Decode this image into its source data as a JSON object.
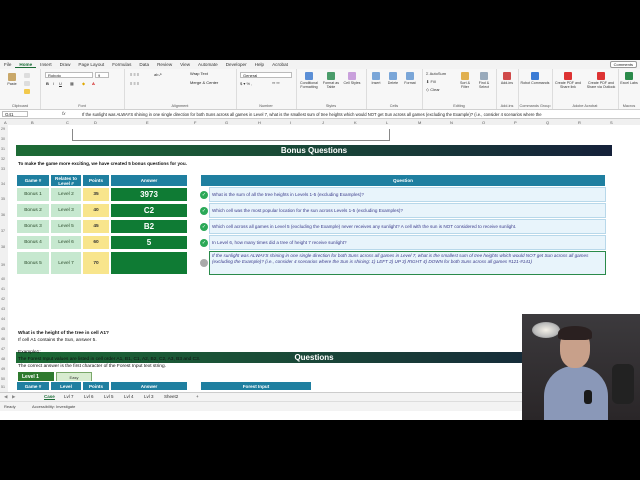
{
  "menu": {
    "tabs": [
      "File",
      "Home",
      "Insert",
      "Draw",
      "Page Layout",
      "Formulas",
      "Data",
      "Review",
      "View",
      "Automate",
      "Developer",
      "Help",
      "Acrobat"
    ],
    "active": "Home",
    "comments_label": "Comments"
  },
  "ribbon": {
    "groups": [
      "Clipboard",
      "Font",
      "Alignment",
      "Number",
      "Styles",
      "Cells",
      "Editing",
      "Add-ins",
      "Commands Group",
      "Adobe Acrobat",
      "Macros"
    ],
    "font_name": "Roboto",
    "font_size": "9",
    "number_format": "General",
    "wrap_text": "Wrap Text",
    "merge_center": "Merge & Center",
    "paste": "Paste",
    "conditional_formatting": "Conditional Formatting",
    "format_as_table": "Format as Table",
    "cell_styles": "Cell Styles",
    "insert": "Insert",
    "delete": "Delete",
    "format": "Format",
    "autosum": "AutoSum",
    "fill": "Fill",
    "clear": "Clear",
    "sort_filter": "Sort & Filter",
    "find_select": "Find & Select",
    "addins": "Add-ins",
    "robot_commands": "Robot Commands",
    "create_pdf_share": "Create PDF and Share link",
    "create_pdf_outlook": "Create PDF and Share via Outlook",
    "excel_labs": "Excel Labs"
  },
  "formula_bar": {
    "name_box": "G41",
    "fx": "fx",
    "formula": "If the sunlight was ALWAYS shining in one single direction for both Suns across all games in Level 7, what is the smallest sum of tree heights which would NOT get Sun across all games (excluding the Example)? (i.e., consider 4 scenarios where the"
  },
  "columns": [
    "A",
    "B",
    "C",
    "D",
    "E",
    "F",
    "G",
    "H",
    "I",
    "J",
    "K",
    "L",
    "M",
    "N",
    "O",
    "P",
    "Q",
    "R",
    "S"
  ],
  "rows": [
    "29",
    "30",
    "31",
    "32",
    "33",
    "34",
    "35",
    "36",
    "37",
    "38",
    "39",
    "40",
    "41",
    "42",
    "43",
    "44",
    "45",
    "46",
    "47",
    "48",
    "49",
    "50",
    "51",
    "52",
    "53",
    "54"
  ],
  "bonus": {
    "title": "Bonus Questions",
    "intro": "To make the game more exciting, we have created 5 bonus questions for you.",
    "headers": [
      "Game #",
      "Relates to Level #",
      "Points",
      "Answer",
      "Question"
    ],
    "rows": [
      {
        "game": "Bonus 1",
        "level": "Level 2",
        "points": "35",
        "answer": "3973",
        "question": "What is the sum of all the tree heights in Levels 1-5 (excluding Examples)?",
        "status": "correct"
      },
      {
        "game": "Bonus 2",
        "level": "Level 3",
        "points": "40",
        "answer": "C2",
        "question": "Which cell was the most popular location for the sun across Levels 1-5 (excluding Examples)?",
        "status": "correct"
      },
      {
        "game": "Bonus 3",
        "level": "Level 5",
        "points": "45",
        "answer": "B2",
        "question": "Which cell across all games in Level 5 (excluding the Example) never receives any sunlight? A cell with the sun is NOT considered to receive sunlight.",
        "status": "correct"
      },
      {
        "game": "Bonus 4",
        "level": "Level 6",
        "points": "60",
        "answer": "5",
        "question": "In Level 6, how many times did a tree of height 7 receive sunlight?",
        "status": "correct"
      },
      {
        "game": "Bonus 5",
        "level": "Level 7",
        "points": "70",
        "answer": "",
        "question": "If the sunlight was ALWAYS shining in one single direction for both Suns across all games in Level 7, what is the smallest sum of tree heights which would NOT get Sun across all games (excluding the Example)? (i.e., consider 4 scenarios where the Sun is shining: 1) LEFT 2) UP 3) RIGHT 4) DOWN for both Suns across all games #121-#141)",
        "status": "pending"
      }
    ]
  },
  "questions": {
    "title": "Questions",
    "level_label": "Level 1",
    "difficulty": "Easy",
    "q_title": "What is the height of the tree in cell A1?",
    "q_line": "If cell A1 contains the Sun, answer 5.",
    "example_label": "Example1:",
    "example_line1": "The Forest Input values are listed in cell order A1, B1, C1, A2, B2, C2, A3, B3 and C3.",
    "example_line2": "The correct answer is the first character of the Forest Input text string.",
    "headers": [
      "Game #",
      "Level",
      "Points",
      "Answer",
      "Forest Input"
    ]
  },
  "sheet_tabs": [
    "Case",
    "Lvl 7",
    "Lvl 6",
    "Lvl 5",
    "Lvl 4",
    "Lvl 3",
    "Sheet2"
  ],
  "active_sheet": "Case",
  "status": {
    "ready": "Ready",
    "accessibility": "Accessibility: Investigate"
  }
}
